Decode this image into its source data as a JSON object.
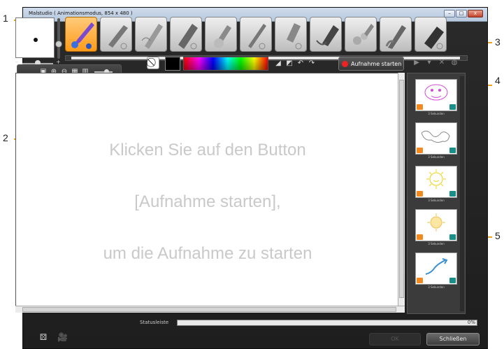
{
  "window": {
    "title": "Malstudio ( Animationsmodus, 854 x 480 )",
    "buttons": [
      "–",
      "□",
      "x"
    ]
  },
  "tools": [
    {
      "name": "brush",
      "active": true
    },
    {
      "name": "airbrush"
    },
    {
      "name": "eraser-pen"
    },
    {
      "name": "marker"
    },
    {
      "name": "smudge"
    },
    {
      "name": "pencil"
    },
    {
      "name": "chalk"
    },
    {
      "name": "fill-marker"
    },
    {
      "name": "stamp"
    },
    {
      "name": "paint-brush"
    },
    {
      "name": "eraser"
    }
  ],
  "toolbar": {
    "record_label": "Aufnahme starten",
    "color": "#000000"
  },
  "canvas": {
    "lines": [
      "Klicken Sie auf den Button",
      "[Aufnahme starten],",
      "um die Aufnahme zu starten"
    ]
  },
  "storyboard": {
    "frames": [
      {
        "label": "3 Sekunden",
        "color": "#d44ad4"
      },
      {
        "label": "3 Sekunden",
        "color": "#888888"
      },
      {
        "label": "3 Sekunden",
        "color": "#e9d31a"
      },
      {
        "label": "3 Sekunden",
        "color": "#f0c24a"
      },
      {
        "label": "3 Sekunden",
        "color": "#3a8fcf"
      }
    ]
  },
  "status": {
    "label": "Statusleiste",
    "progress_pct": "0%"
  },
  "footer": {
    "ok_label": "OK",
    "close_label": "Schließen"
  },
  "callouts": [
    "1",
    "2",
    "3",
    "4",
    "5"
  ],
  "accent": "#f0a020"
}
